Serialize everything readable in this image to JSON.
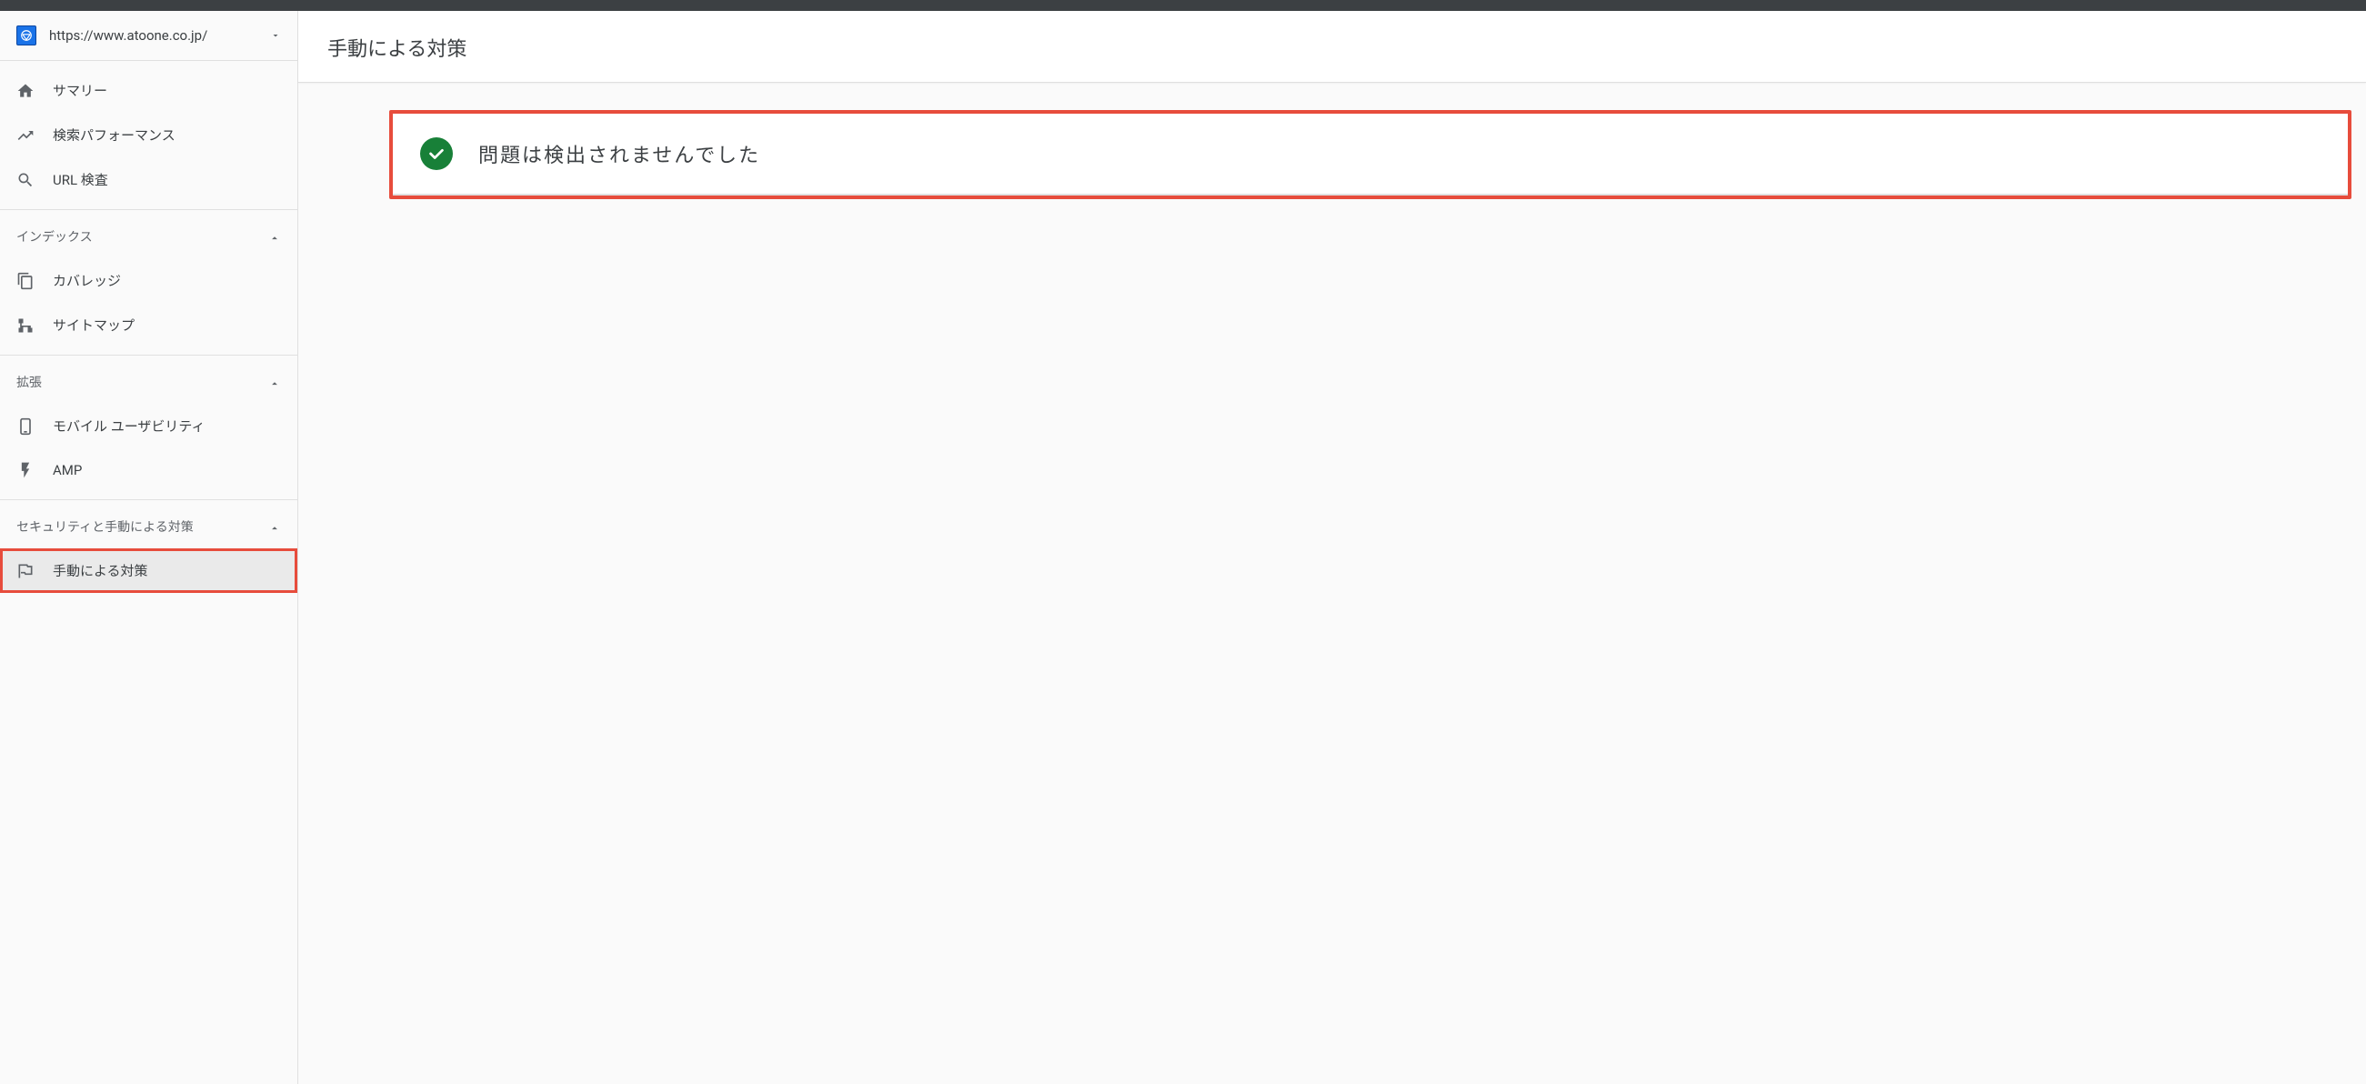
{
  "property": {
    "url": "https://www.atoone.co.jp/"
  },
  "nav": {
    "summary": "サマリー",
    "perf": "検索パフォーマンス",
    "urlInspect": "URL 検査",
    "indexHeader": "インデックス",
    "coverage": "カバレッジ",
    "sitemap": "サイトマップ",
    "enhanceHeader": "拡張",
    "mobile": "モバイル ユーザビリティ",
    "amp": "AMP",
    "securityHeader": "セキュリティと手動による対策",
    "manual": "手動による対策"
  },
  "main": {
    "title": "手動による対策",
    "result": "問題は検出されませんでした"
  }
}
